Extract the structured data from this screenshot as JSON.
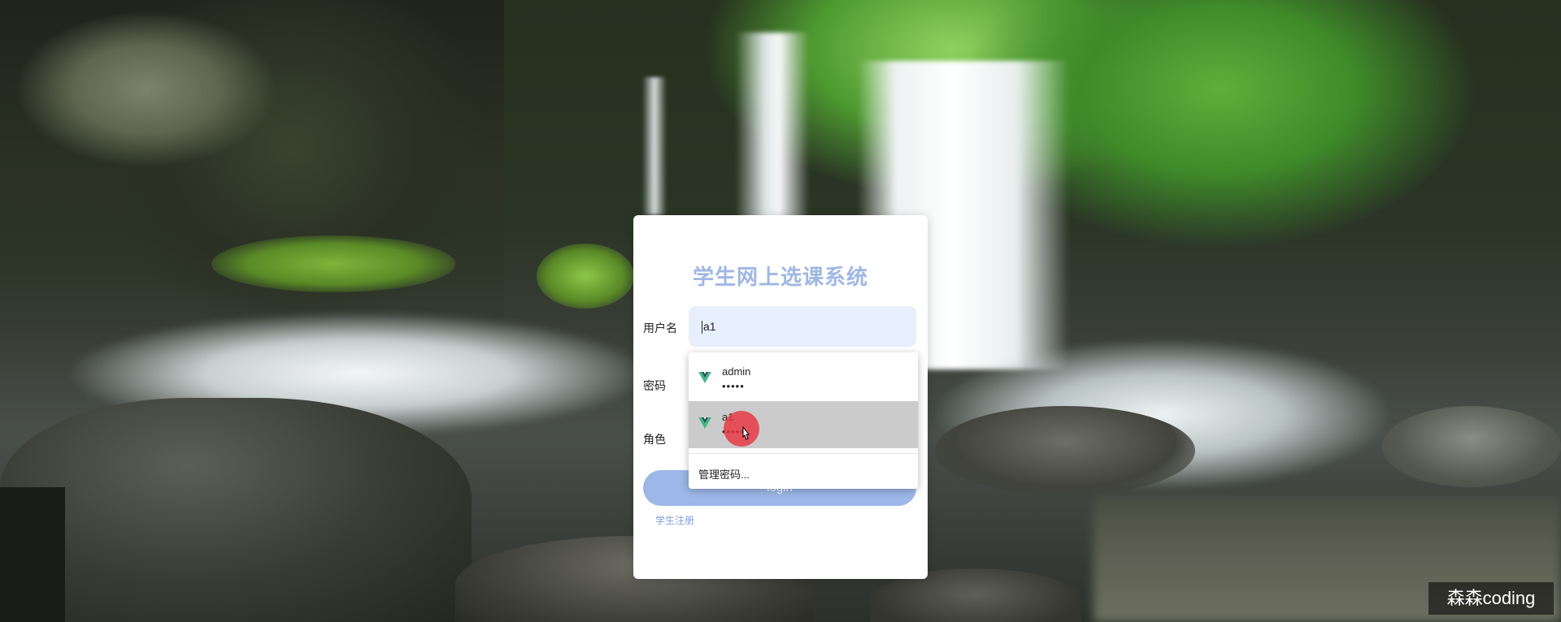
{
  "app": {
    "title": "学生网上选课系统"
  },
  "login_form": {
    "username_label": "用户名",
    "username_value": "a1",
    "password_label": "密码",
    "role_label": "角色",
    "login_button": "login",
    "register_link": "学生注册"
  },
  "autofill": {
    "icon": "vue-logo-icon",
    "items": [
      {
        "username": "admin",
        "password_mask": "•••••"
      },
      {
        "username": "a1",
        "password_mask": "•••••"
      }
    ],
    "manage_label": "管理密码..."
  },
  "watermark": "森森coding",
  "colors": {
    "title": "#9fb7e3",
    "button": "#9db7e8",
    "input_bg": "#e8effc",
    "link": "#7f9fd8",
    "vue_green": "#41b883",
    "vue_dark": "#35495e",
    "click_indicator": "#e83440"
  }
}
